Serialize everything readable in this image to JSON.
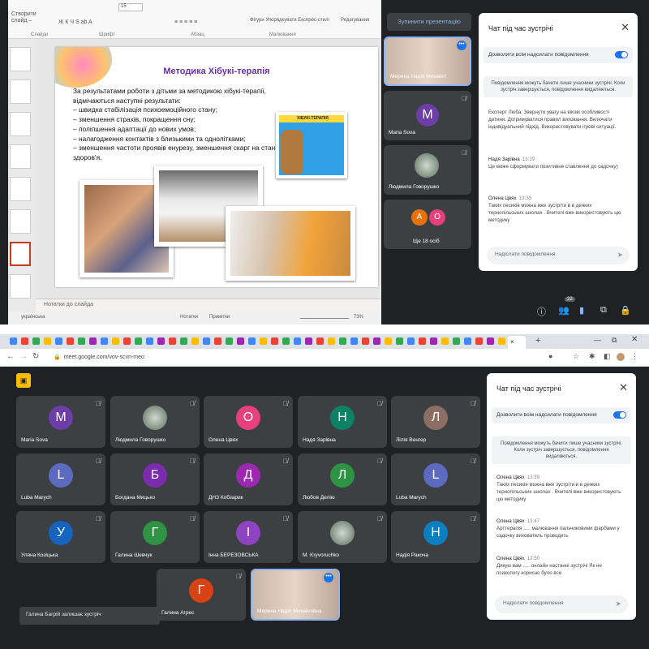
{
  "ppt": {
    "ribbon": {
      "row1": "Створити слайд –",
      "row1b": "Ж К Ч S ab A",
      "font_size": "15",
      "figures": "Фігури Упорядкувати Експрес-стилі",
      "editing": "Редагування",
      "groups": [
        "Слайди",
        "Шрифт",
        "Абзац",
        "Малювання"
      ]
    },
    "slide": {
      "title": "Методика Хібукі-терапія",
      "body": [
        "За результатами роботи з дітьми за методикою хібукі-терапії, відмічаються наступні результати:",
        "– швидка стабілізація психоемоційного стану;",
        "– зменшення страхів, покращення сну;",
        "– поліпшення адаптації до нових умов;",
        "– налагодження контактів з близькими та однолітками;",
        "– зменшення частоти проявів енурезу, зменшення скарг на стан здоров'я."
      ],
      "poster_title": "ХІБУКІ-ТЕРАПІЯ"
    },
    "notes_placeholder": "Нотатки до слайда",
    "status": {
      "lang": "українська",
      "notes": "Нотатки",
      "comments": "Примітки",
      "zoom": "73%"
    }
  },
  "meet_top": {
    "stop_presenting": "Зупинити презентацію",
    "tiles": [
      {
        "name": "Мерена Надія Михайлі",
        "initial": ""
      },
      {
        "name": "Maria Sova",
        "initial": "M",
        "color": "#6d3ea8"
      },
      {
        "name": "Людмила Говорушко",
        "initial": ""
      },
      {
        "name": "Ще 18 осіб",
        "initial": ""
      }
    ],
    "more_avatars": [
      "А",
      "О"
    ],
    "participants_count": "22",
    "chat": {
      "title": "Чат під час зустрічі",
      "allow_label": "Дозволити всім надсилати повідомлення",
      "notice": "Повідомлення можуть бачити лише учасники зустрічі. Коли зустріч завершується, повідомлення видаляються.",
      "messages": [
        {
          "sender": "",
          "time": "",
          "text": "Експерт Люба: Звернути увагу на вікові особливості дитини. Догримуватися правил виховання. Включати індивідуальний підхід. Використовувати ігрові ситуації."
        },
        {
          "sender": "Надя Зарівна",
          "time": "13:29",
          "text": "Це може сформувати позитивне ставлення до садочку)"
        },
        {
          "sender": "Олена Цвях",
          "time": "13:39",
          "text": "Таких песиків можна вже зустріти в в деяких тернопільських школах . Вчителі вже використовують цю методику"
        }
      ],
      "input_placeholder": "Надіслати повідомлення"
    }
  },
  "browser": {
    "url": "meet.google.com/vov-scvn-meo",
    "tab_close": "×",
    "new_tab": "+"
  },
  "meet_bottom": {
    "participants": [
      {
        "name": "Maria Sova",
        "initial": "M",
        "color": "#6d3ea8"
      },
      {
        "name": "Людмила Говорушко",
        "initial": "",
        "color": ""
      },
      {
        "name": "Олена Цвях",
        "initial": "О",
        "color": "#e8407a"
      },
      {
        "name": "Надя Зарівна",
        "initial": "Н",
        "color": "#0b8165"
      },
      {
        "name": "Лілія Венгер",
        "initial": "Л",
        "color": "#8d6e63"
      },
      {
        "name": "Luba Marych",
        "initial": "L",
        "color": "#5c6bc0"
      },
      {
        "name": "Богдана Мицько",
        "initial": "Б",
        "color": "#7b2cad"
      },
      {
        "name": "ДНЗ Кобзарик",
        "initial": "Д",
        "color": "#9c27b0"
      },
      {
        "name": "Любов Делію",
        "initial": "Л",
        "color": "#2e9444"
      },
      {
        "name": "Luba Marych",
        "initial": "L",
        "color": "#5c6bc0"
      },
      {
        "name": "Уляна Козіцька",
        "initial": "У",
        "color": "#1565c0"
      },
      {
        "name": "Галина Шевчук",
        "initial": "Г",
        "color": "#2e9444"
      },
      {
        "name": "Інна БЕРЕЗОВСЬКА",
        "initial": "І",
        "color": "#8e44c0"
      },
      {
        "name": "M. Kryvoruchko",
        "initial": "",
        "color": ""
      },
      {
        "name": "Надія Ракоча",
        "initial": "Н",
        "color": "#0b7fc0"
      },
      {
        "name": "Галина Агрес",
        "initial": "Г",
        "color": "#d84315"
      },
      {
        "name": "Мерена Надія Михайлівна",
        "initial": "",
        "color": ""
      }
    ],
    "toast": "Галина Багрій залишає зустріч",
    "chat": {
      "title": "Чат під час зустрічі",
      "allow_label": "Дозволити всім надсилати повідомлення",
      "notice": "Повідомлення можуть бачити лише учасники зустрічі. Коли зустріч завершується, повідомлення видаляються.",
      "messages": [
        {
          "sender": "Олена Цвях",
          "time": "13:39",
          "text": "Таких песиків можна вже зустріти в в деяких тернопільських школах . Вчителі вже використовують цю методику"
        },
        {
          "sender": "Олена Цвях",
          "time": "13:47",
          "text": "Арттерапія ..... малювання пальчиковими фарбами у садочку вихователь проводить"
        },
        {
          "sender": "Олена Цвях",
          "time": "13:50",
          "text": "Дякую вам ..... онлайн настанні зустрічі Як не психологу корисно було все"
        }
      ],
      "input_placeholder": "Надіслати повідомлення"
    },
    "reactions": [
      "💖",
      "👍",
      "🎉",
      "👏",
      "😂",
      "😮",
      "😢",
      "🤔",
      "👎"
    ]
  }
}
